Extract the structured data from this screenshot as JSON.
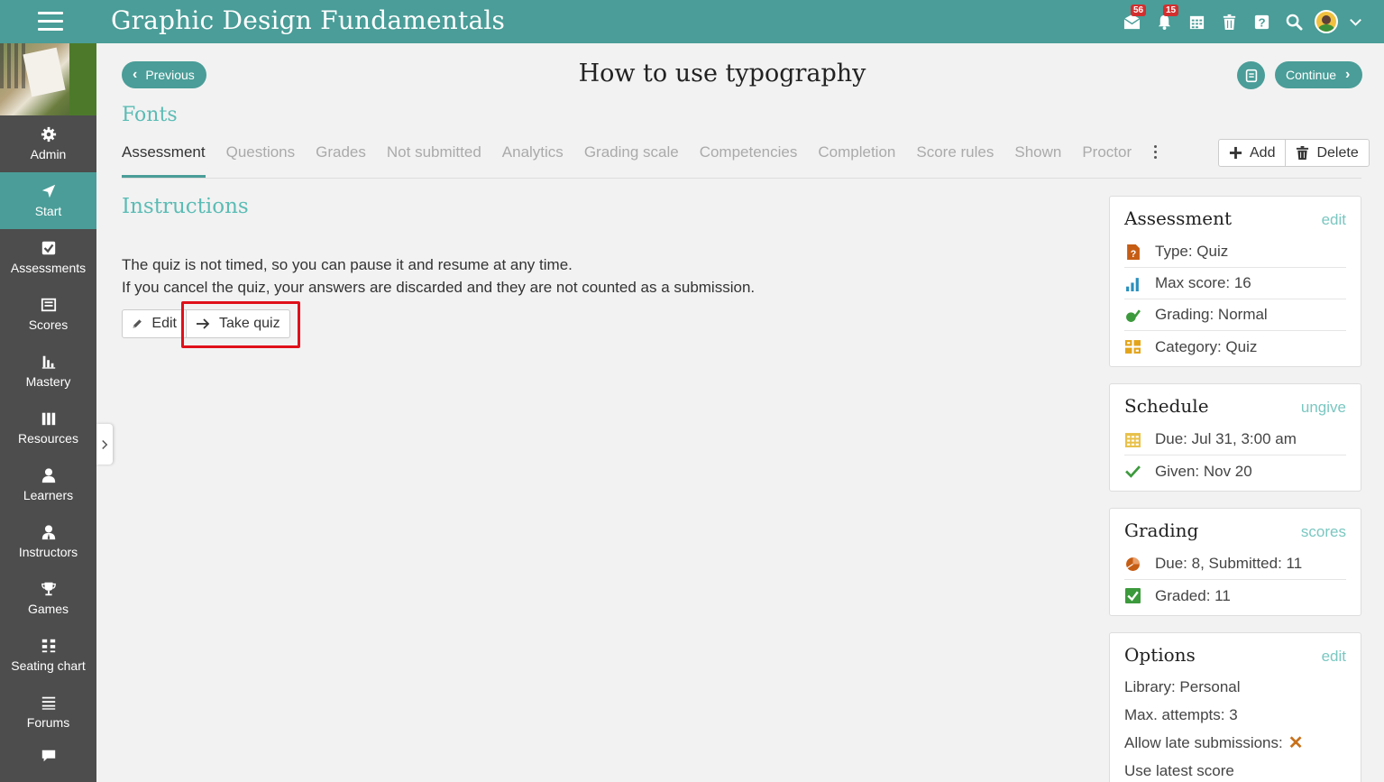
{
  "app": {
    "title": "Graphic Design Fundamentals",
    "badges": {
      "messages": "56",
      "notifications": "15"
    }
  },
  "sidebar": {
    "items": [
      {
        "label": "Admin",
        "icon": "gear-icon"
      },
      {
        "label": "Start",
        "icon": "navigation-arrow-icon"
      },
      {
        "label": "Assessments",
        "icon": "checkbox-icon"
      },
      {
        "label": "Scores",
        "icon": "gradebook-icon"
      },
      {
        "label": "Mastery",
        "icon": "bar-chart-icon"
      },
      {
        "label": "Resources",
        "icon": "books-icon"
      },
      {
        "label": "Learners",
        "icon": "person-icon"
      },
      {
        "label": "Instructors",
        "icon": "instructor-icon"
      },
      {
        "label": "Games",
        "icon": "trophy-icon"
      },
      {
        "label": "Seating chart",
        "icon": "seating-grid-icon"
      },
      {
        "label": "Forums",
        "icon": "list-icon"
      }
    ]
  },
  "header": {
    "previous": "Previous",
    "continue": "Continue",
    "page_title": "How to use typography",
    "section": "Fonts"
  },
  "tabs": [
    "Assessment",
    "Questions",
    "Grades",
    "Not submitted",
    "Analytics",
    "Grading scale",
    "Competencies",
    "Completion",
    "Score rules",
    "Shown",
    "Proctor"
  ],
  "toolbar": {
    "add": "Add",
    "delete": "Delete"
  },
  "instructions": {
    "title": "Instructions",
    "line1": "The quiz is not timed, so you can pause it and resume at any time.",
    "line2": "If you cancel the quiz, your answers are discarded and they are not counted as a submission.",
    "edit": "Edit",
    "take_quiz": "Take quiz"
  },
  "panels": {
    "assessment": {
      "title": "Assessment",
      "link": "edit",
      "rows": [
        "Type: Quiz",
        "Max score: 16",
        "Grading: Normal",
        "Category: Quiz"
      ]
    },
    "schedule": {
      "title": "Schedule",
      "link": "ungive",
      "rows": [
        "Due: Jul 31, 3:00 am",
        "Given: Nov 20"
      ]
    },
    "grading": {
      "title": "Grading",
      "link": "scores",
      "rows": [
        "Due: 8, Submitted: 11",
        "Graded: 11"
      ]
    },
    "options": {
      "title": "Options",
      "link": "edit",
      "rows": [
        "Library: Personal",
        "Max. attempts: 3",
        "Allow late submissions:",
        "Use latest score"
      ]
    }
  },
  "colors": {
    "accent": "#4a9d98",
    "accent_light": "#5bbcb5",
    "sidebar": "#4d4d4d",
    "highlight": "#e0101a"
  }
}
